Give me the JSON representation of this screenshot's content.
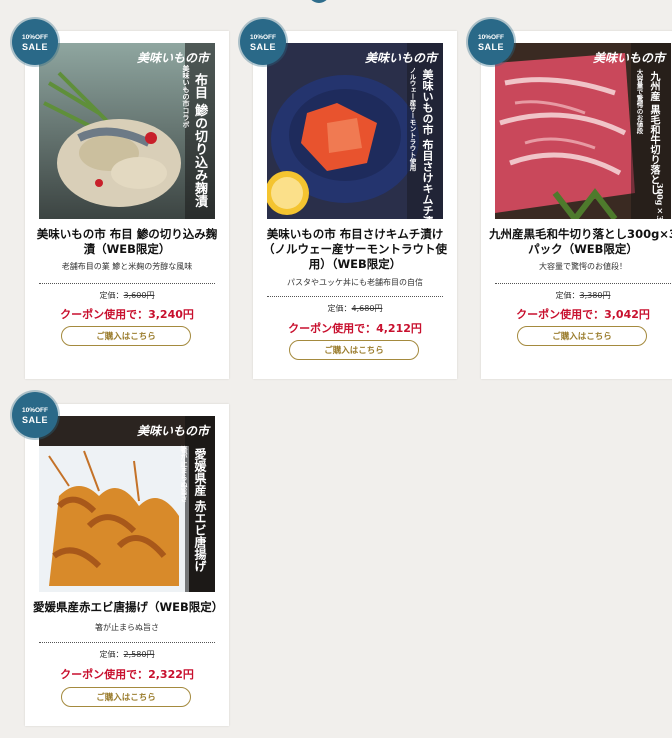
{
  "badge": {
    "line1": "10%OFF",
    "line2": "SALE"
  },
  "labels": {
    "price_prefix": "定価：",
    "price_suffix": "円",
    "coupon_prefix": "クーポン使用で：",
    "coupon_suffix": "円",
    "buy_button": "ご購入はこちら"
  },
  "products": [
    {
      "title": "美味いもの市 布目 鯵の切り込み麹漬（WEB限定）",
      "subtitle": "老舗布目の業 鯵と米麹の芳醇な風味",
      "list_price": "3,600",
      "coupon_price": "3,240",
      "image_overlay": [
        "布目 鯵の切り込み麹漬",
        "美味いもの市コラボ"
      ],
      "image_logo": "美味いもの市"
    },
    {
      "title": "美味いもの市 布目さけキムチ漬け（ノルウェー産サーモントラウト使用）（WEB限定）",
      "subtitle": "パスタやユッケ丼にも老舗布目の自信",
      "list_price": "4,680",
      "coupon_price": "4,212",
      "image_overlay": [
        "美味いもの市 布目さけキムチ漬け",
        "ノルウェー産サーモントラウト使用"
      ],
      "image_logo": "美味いもの市"
    },
    {
      "title": "九州産黒毛和牛切り落とし300g×3パック（WEB限定）",
      "subtitle": "大容量で驚愕のお値段！",
      "list_price": "3,380",
      "coupon_price": "3,042",
      "image_overlay": [
        "九州産 黒毛和牛切り落とし",
        "大容量で驚愕のお値段",
        "300g×3"
      ],
      "image_logo": "美味いもの市"
    },
    {
      "title": "愛媛県産赤エビ唐揚げ（WEB限定）",
      "subtitle": "箸が止まらぬ旨さ",
      "list_price": "2,580",
      "coupon_price": "2,322",
      "image_overlay": [
        "愛媛県産 赤エビ唐揚げ",
        "箸が止まらぬ旨さ"
      ],
      "image_logo": "美味いもの市"
    }
  ]
}
